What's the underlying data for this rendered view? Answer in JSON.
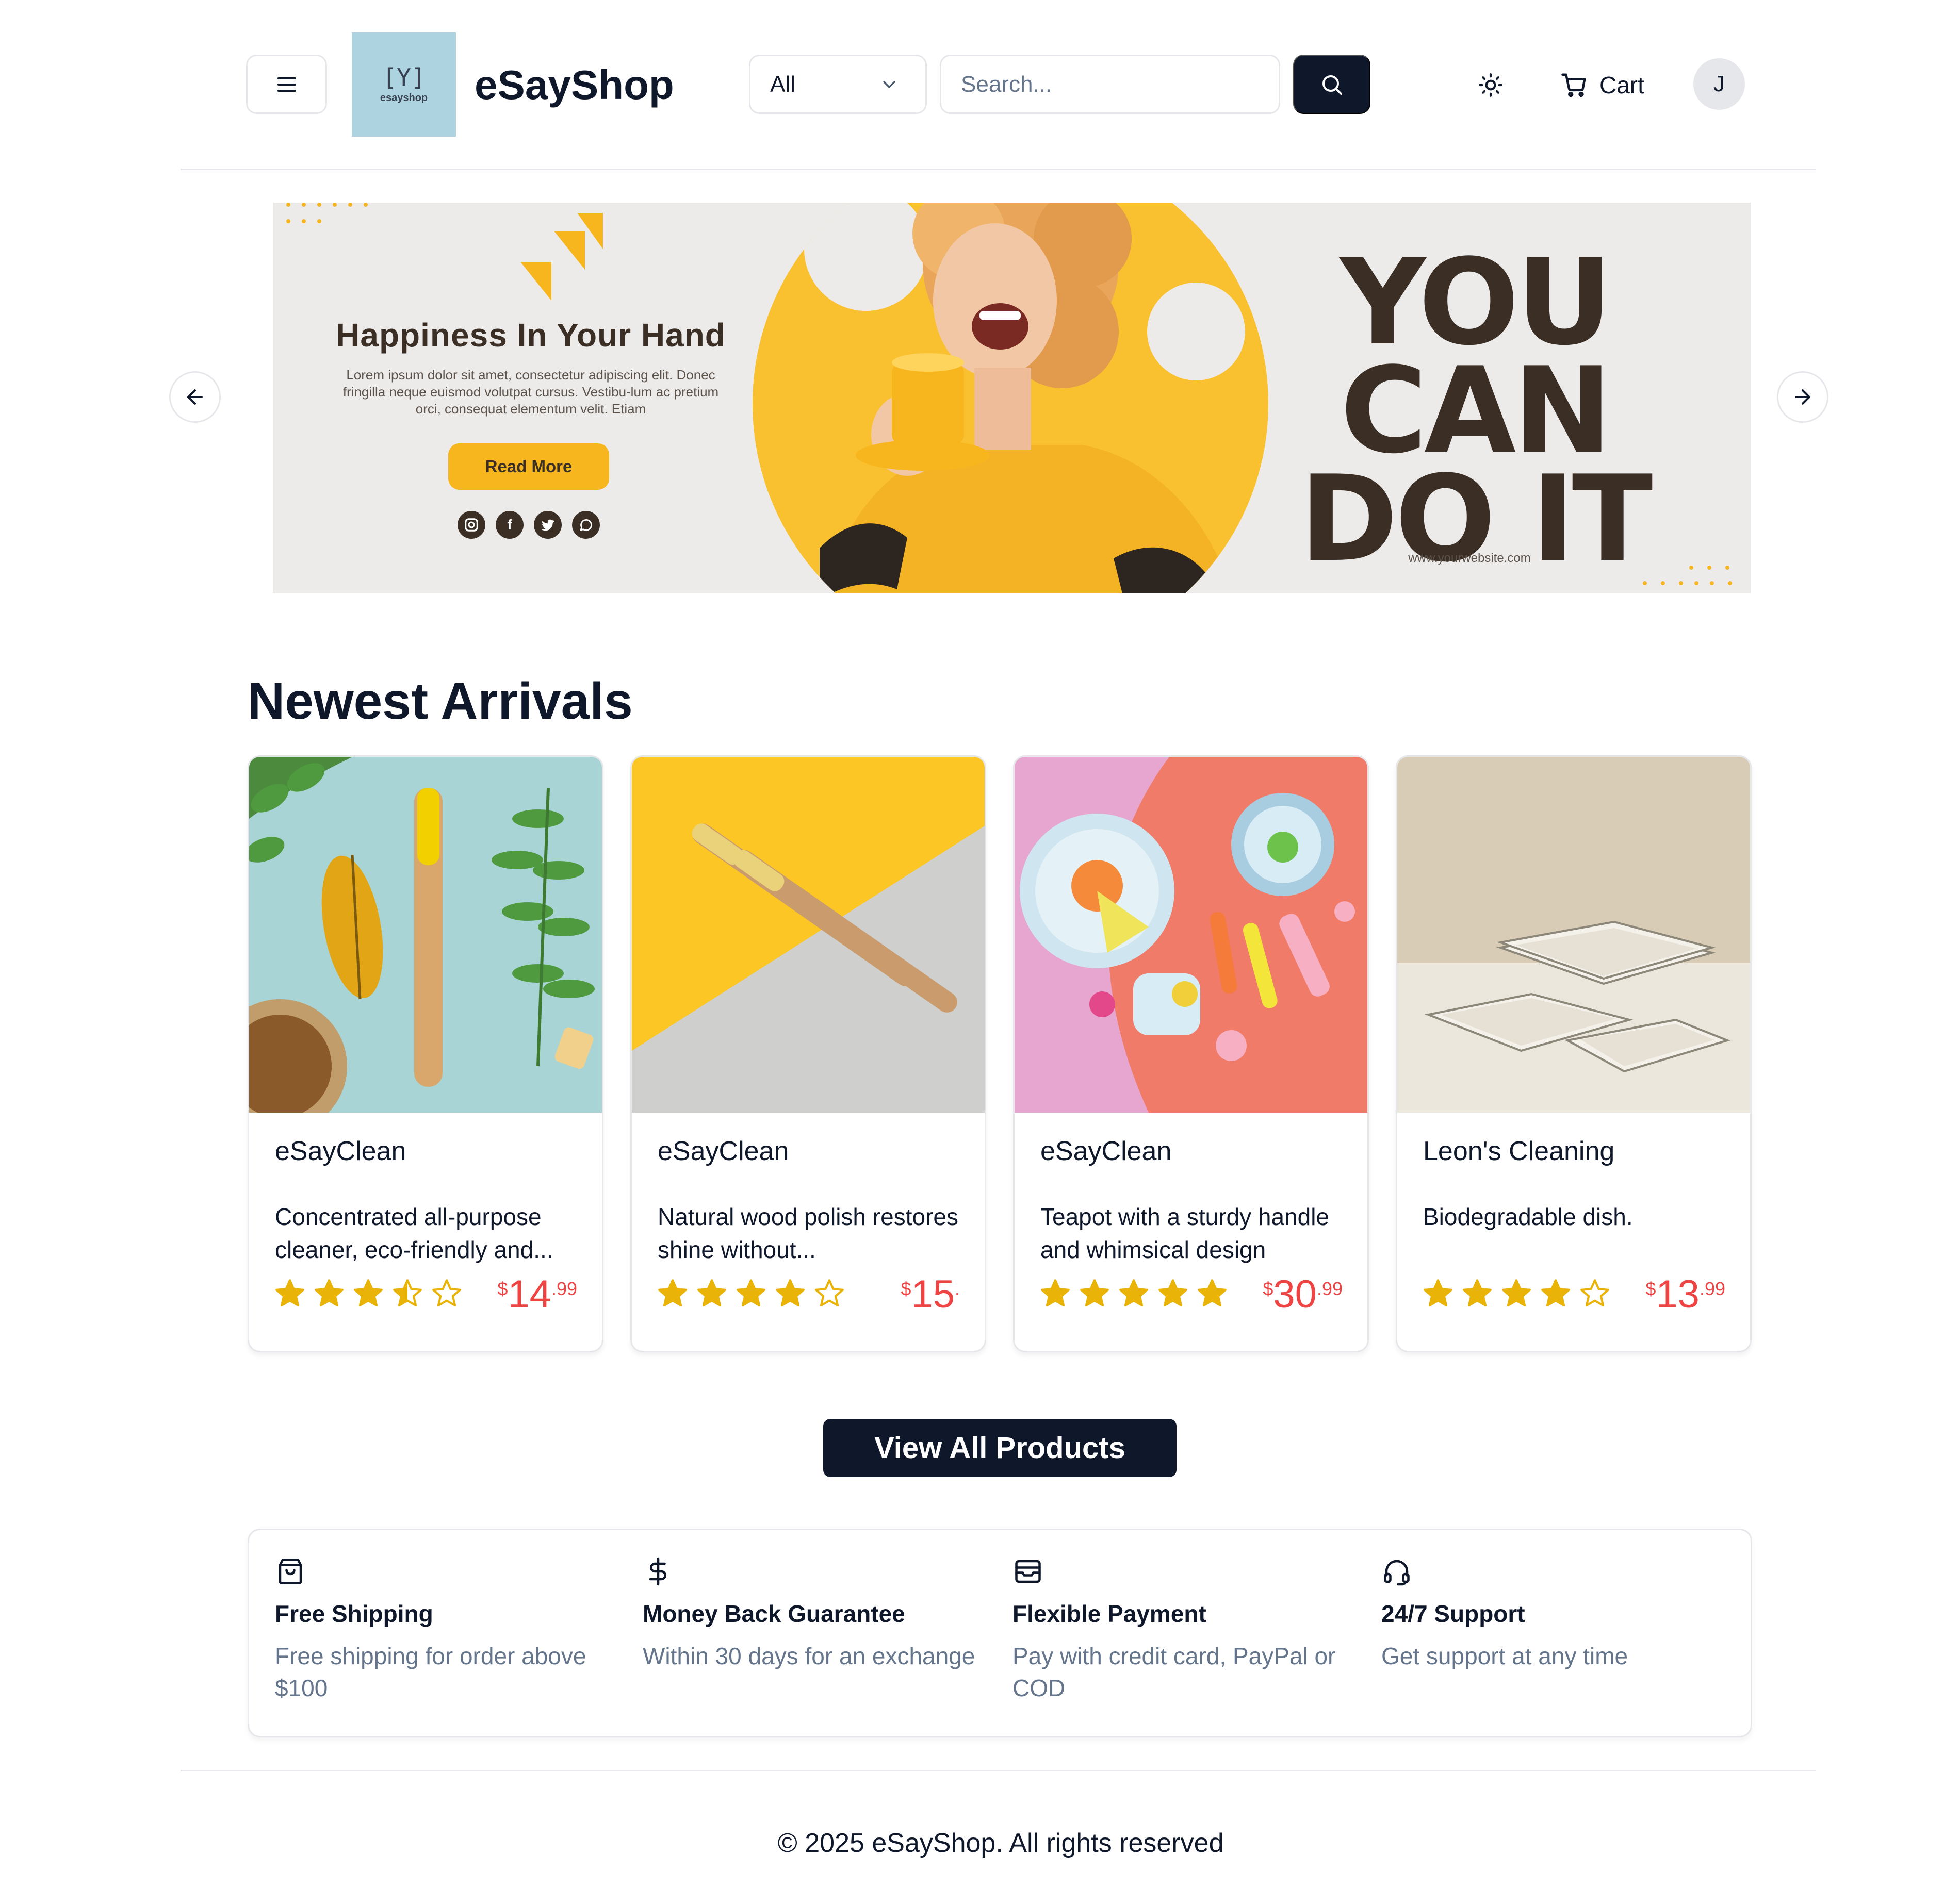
{
  "header": {
    "logo_mark": "[Y]",
    "logo_caption": "esayshop",
    "brand": "eSayShop",
    "category_select": "All",
    "search_placeholder": "Search...",
    "cart_label": "Cart",
    "avatar_initial": "J"
  },
  "banner": {
    "headline": "Happiness In Your Hand",
    "body": "Lorem ipsum dolor sit amet, consectetur adipiscing elit. Donec fringilla neque euismod volutpat cursus. Vestibu-lum ac pretium orci, consequat elementum velit. Etiam",
    "button": "Read More",
    "slogan_line1": "YOU",
    "slogan_line2": "CAN",
    "slogan_line3": "DO IT",
    "website": "www.yourwebsite.com",
    "social_icons": [
      "instagram-icon",
      "facebook-icon",
      "twitter-icon",
      "whatsapp-icon"
    ],
    "colors": {
      "accent": "#f8b61e",
      "dark": "#3a2e25",
      "background": "#edebe9"
    }
  },
  "arrivals": {
    "title": "Newest Arrivals",
    "products": [
      {
        "brand": "eSayClean",
        "description": "Concentrated all-purpose cleaner, eco-friendly and...",
        "rating": 3.5,
        "currency": "$",
        "price_whole": "14",
        "price_cents": ".99"
      },
      {
        "brand": "eSayClean",
        "description": "Natural wood polish restores shine without...",
        "rating": 4,
        "currency": "$",
        "price_whole": "15",
        "price_cents": "."
      },
      {
        "brand": "eSayClean",
        "description": "Teapot with a sturdy handle and whimsical design",
        "rating": 5,
        "currency": "$",
        "price_whole": "30",
        "price_cents": ".99"
      },
      {
        "brand": "Leon's Cleaning",
        "description": "Biodegradable dish.",
        "rating": 4,
        "currency": "$",
        "price_whole": "13",
        "price_cents": ".99"
      }
    ],
    "view_all": "View All Products"
  },
  "features": [
    {
      "icon": "shopping-bag-icon",
      "title": "Free Shipping",
      "text": "Free shipping for order above $100"
    },
    {
      "icon": "dollar-icon",
      "title": "Money Back Guarantee",
      "text": "Within 30 days for an exchange"
    },
    {
      "icon": "wallet-icon",
      "title": "Flexible Payment",
      "text": "Pay with credit card, PayPal or COD"
    },
    {
      "icon": "headphones-icon",
      "title": "24/7 Support",
      "text": "Get support at any time"
    }
  ],
  "footer": {
    "copyright": "© 2025 eSayShop. All rights reserved"
  },
  "colors": {
    "primary": "#0f172a",
    "price": "#ef4444",
    "star": "#eab308",
    "muted": "#64748b",
    "border": "#e5e7eb"
  }
}
